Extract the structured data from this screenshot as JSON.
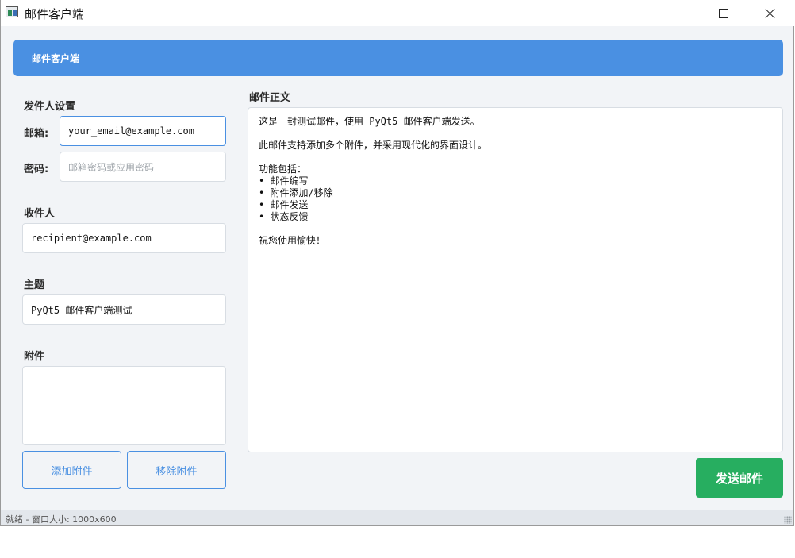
{
  "window": {
    "title": "邮件客户端",
    "icon": "mail-app-icon"
  },
  "header": {
    "title": "邮件客户端",
    "color": "#4a90e2"
  },
  "sender": {
    "section_label": "发件人设置",
    "email_label": "邮箱:",
    "email_value": "your_email@example.com",
    "password_label": "密码:",
    "password_placeholder": "邮箱密码或应用密码"
  },
  "recipient": {
    "section_label": "收件人",
    "value": "recipient@example.com"
  },
  "subject": {
    "section_label": "主题",
    "value": "PyQt5 邮件客户端测试"
  },
  "attachments": {
    "section_label": "附件",
    "items": [],
    "add_label": "添加附件",
    "remove_label": "移除附件"
  },
  "body": {
    "section_label": "邮件正文",
    "lines": [
      "这是一封测试邮件，使用 PyQt5 邮件客户端发送。",
      "",
      "此邮件支持添加多个附件，并采用现代化的界面设计。",
      "",
      "功能包括：",
      "• 邮件编写",
      "• 附件添加/移除",
      "• 邮件发送",
      "• 状态反馈",
      "",
      "祝您使用愉快！"
    ]
  },
  "send_button": {
    "label": "发送邮件",
    "color": "#27ae60"
  },
  "status": {
    "text": "就绪 - 窗口大小: 1000x600"
  }
}
